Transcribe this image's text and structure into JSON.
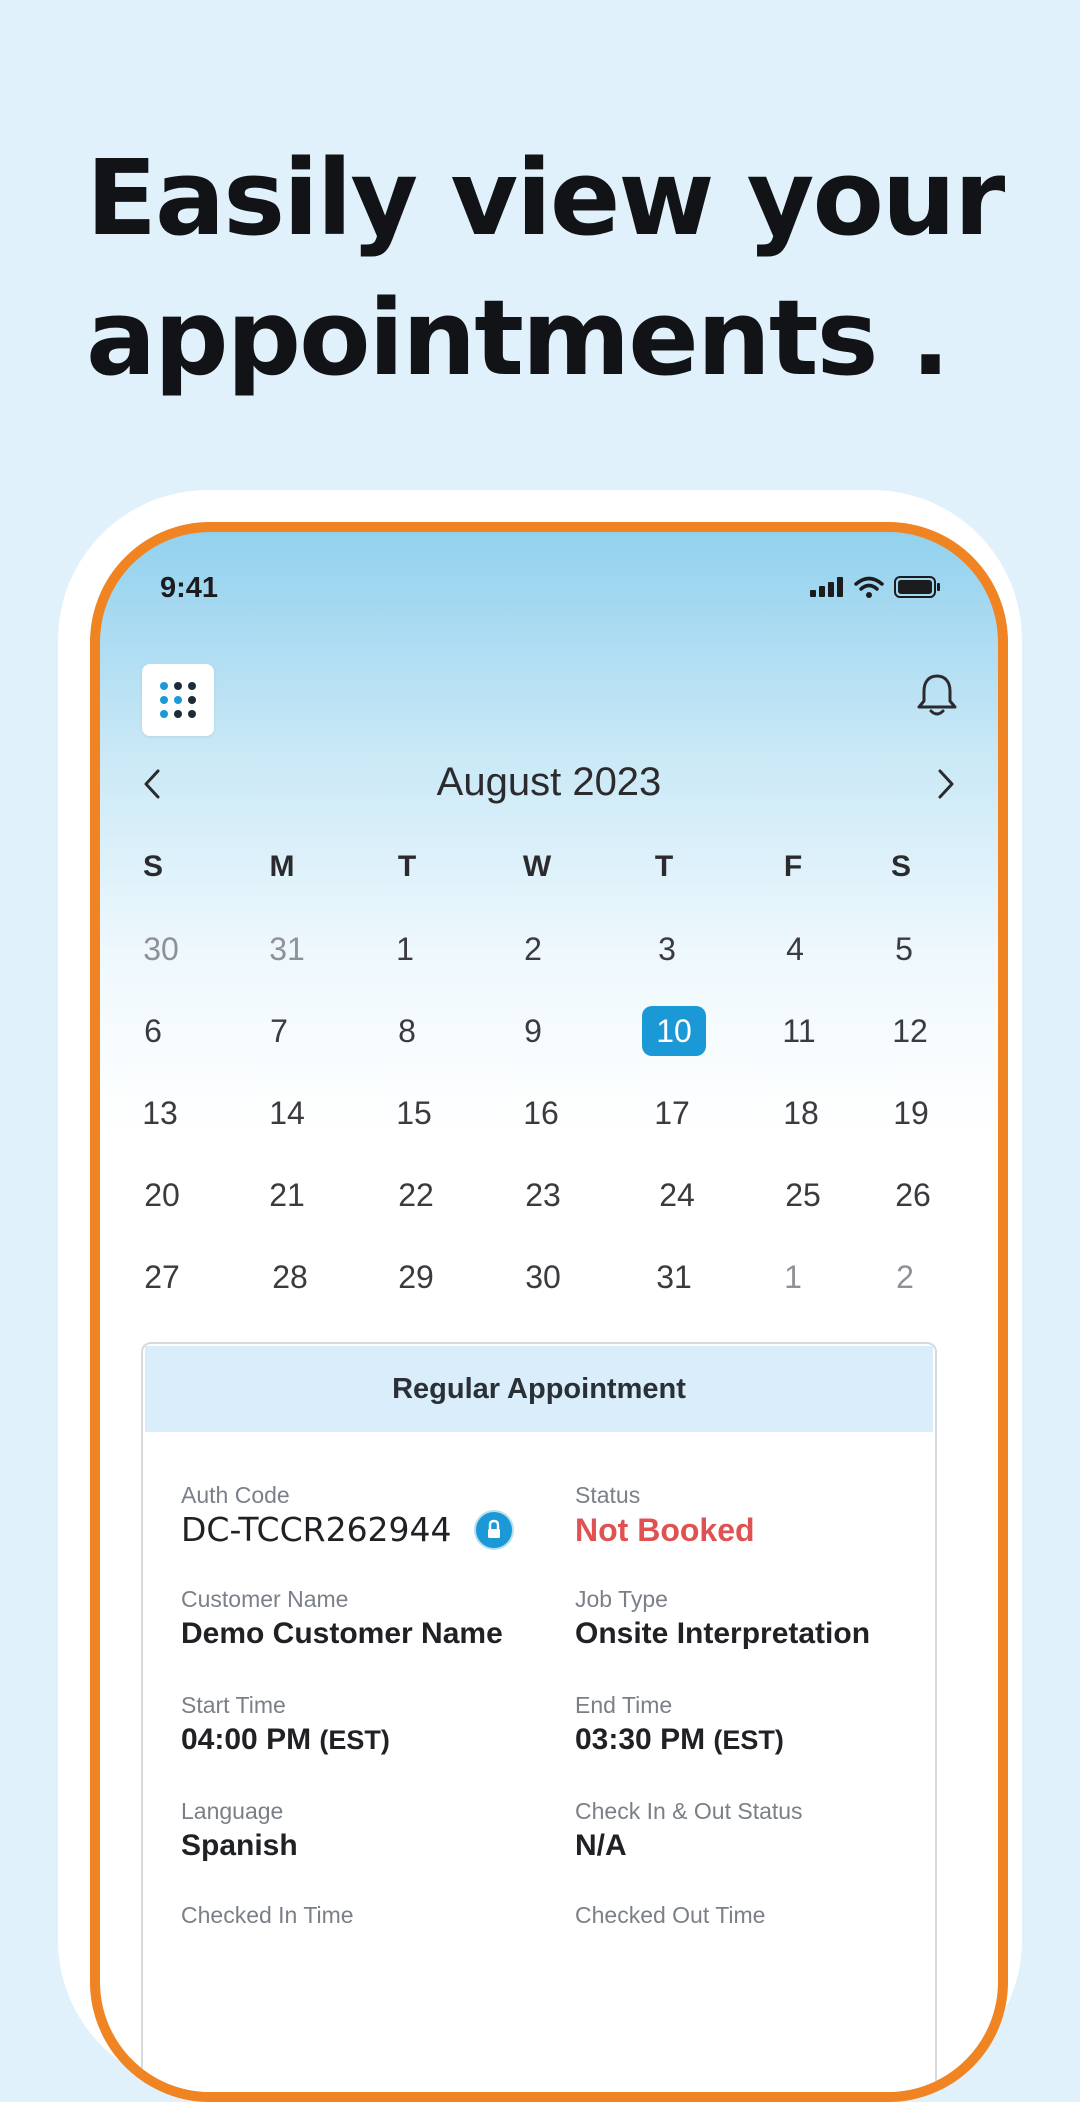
{
  "headline": {
    "line1": "Easily view your",
    "line2": "appointments ."
  },
  "status_bar": {
    "time": "9:41",
    "icons": [
      "signal-icon",
      "wifi-icon",
      "battery-icon"
    ]
  },
  "header": {
    "menu_icon": "grid-menu-icon",
    "notification_icon": "bell-icon"
  },
  "calendar": {
    "month_label": "August 2023",
    "weekdays": [
      "S",
      "M",
      "T",
      "W",
      "T",
      "F",
      "S"
    ],
    "weeks": [
      [
        "30",
        "31",
        "1",
        "2",
        "3",
        "4",
        "5"
      ],
      [
        "6",
        "7",
        "8",
        "9",
        "10",
        "11",
        "12"
      ],
      [
        "13",
        "14",
        "15",
        "16",
        "17",
        "18",
        "19"
      ],
      [
        "20",
        "21",
        "22",
        "23",
        "24",
        "25",
        "26"
      ],
      [
        "27",
        "28",
        "29",
        "30",
        "31",
        "1",
        "2"
      ]
    ],
    "selected_day": "10"
  },
  "appointment": {
    "title": "Regular Appointment",
    "auth_code_label": "Auth Code",
    "auth_code": "DC-TCCR262944",
    "status_label": "Status",
    "status": "Not Booked",
    "customer_label": "Customer Name",
    "customer": "Demo Customer Name",
    "job_type_label": "Job Type",
    "job_type": "Onsite Interpretation",
    "start_label": "Start Time",
    "start_time": "04:00 PM",
    "start_tz": "(EST)",
    "end_label": "End Time",
    "end_time": "03:30 PM",
    "end_tz": "(EST)",
    "language_label": "Language",
    "language": "Spanish",
    "checkinout_label": "Check In & Out Status",
    "checkinout": "N/A",
    "checked_in_label": "Checked In Time",
    "checked_out_label": "Checked Out Time"
  },
  "colors": {
    "accent": "#1a99d6",
    "frame": "#f08422",
    "status_red": "#e05252"
  }
}
